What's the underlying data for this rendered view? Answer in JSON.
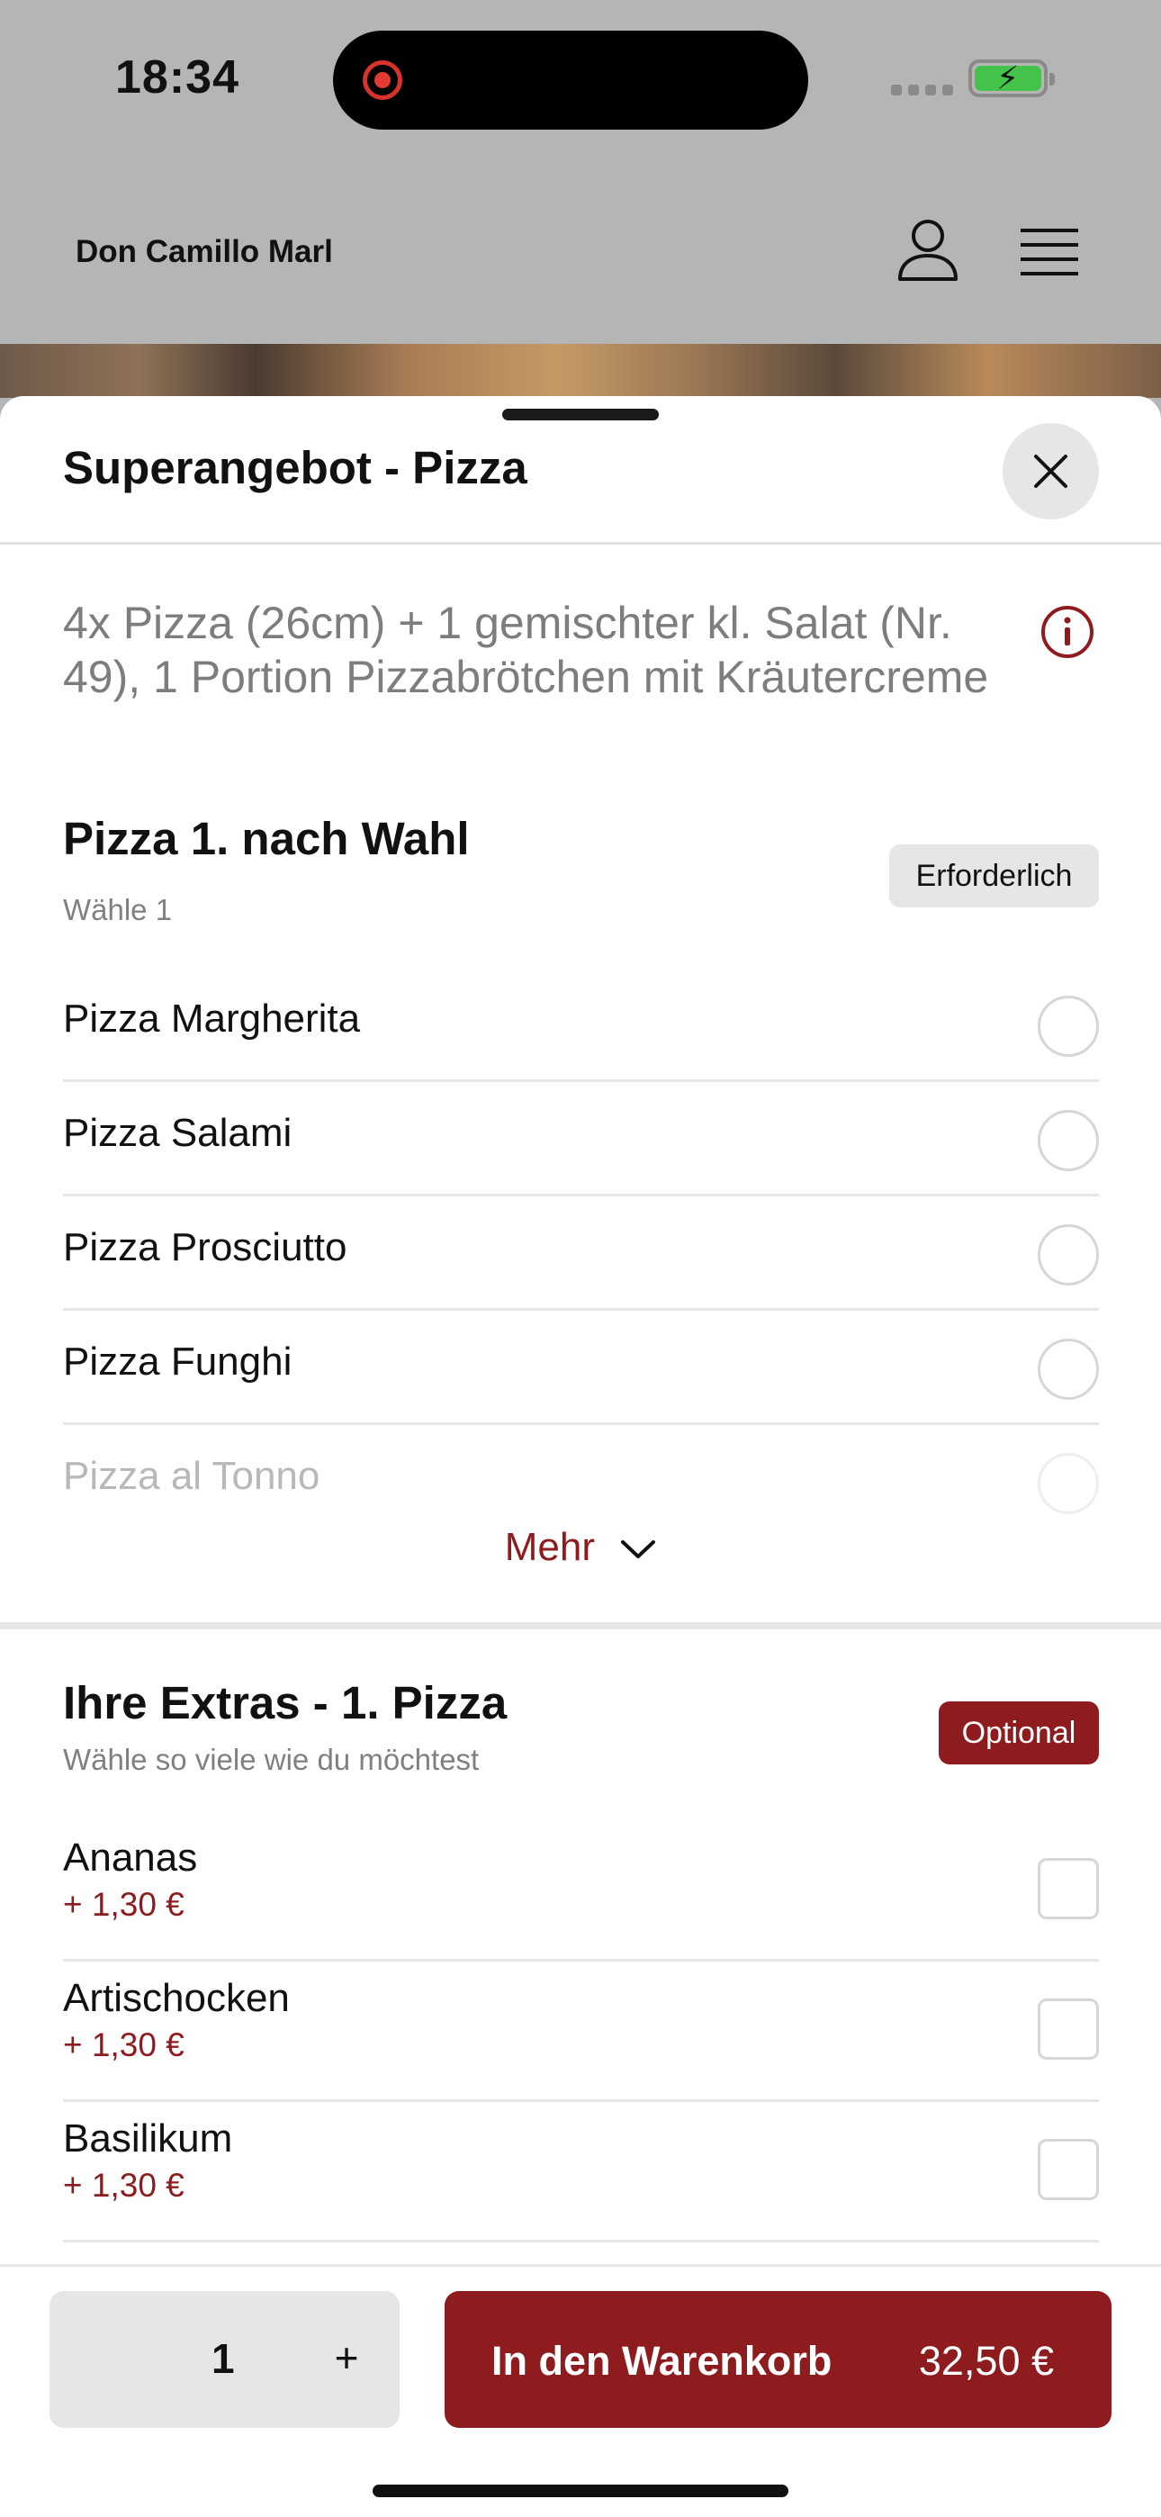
{
  "status_bar": {
    "time": "18:34"
  },
  "header": {
    "brand": "Don Camillo Marl"
  },
  "sheet": {
    "title": "Superangebot - Pizza",
    "description": "4x Pizza (26cm) + 1 gemischter kl. Salat (Nr. 49), 1 Portion Pizzabrötchen mit Kräutercreme"
  },
  "group1": {
    "title": "Pizza 1.  nach Wahl",
    "subtitle": "Wähle 1",
    "badge": "Erforderlich",
    "options": [
      {
        "label": "Pizza Margherita"
      },
      {
        "label": "Pizza Salami"
      },
      {
        "label": "Pizza Prosciutto"
      },
      {
        "label": "Pizza Funghi"
      },
      {
        "label": "Pizza al Tonno"
      }
    ],
    "more_label": "Mehr"
  },
  "group2": {
    "title": "Ihre Extras - 1. Pizza",
    "subtitle": "Wähle so viele wie du möchtest",
    "badge": "Optional",
    "items": [
      {
        "label": "Ananas",
        "price": "+ 1,30 €"
      },
      {
        "label": "Artischocken",
        "price": "+ 1,30 €"
      },
      {
        "label": "Basilikum",
        "price": "+ 1,30 €"
      }
    ]
  },
  "bottom": {
    "quantity": "1",
    "plus": "+",
    "cart_label": "In den Warenkorb",
    "cart_price": "32,50 €"
  },
  "colors": {
    "accent": "#8e1c1f",
    "badge_gray": "#e6e6e6",
    "muted_text": "#7d7d7d"
  }
}
